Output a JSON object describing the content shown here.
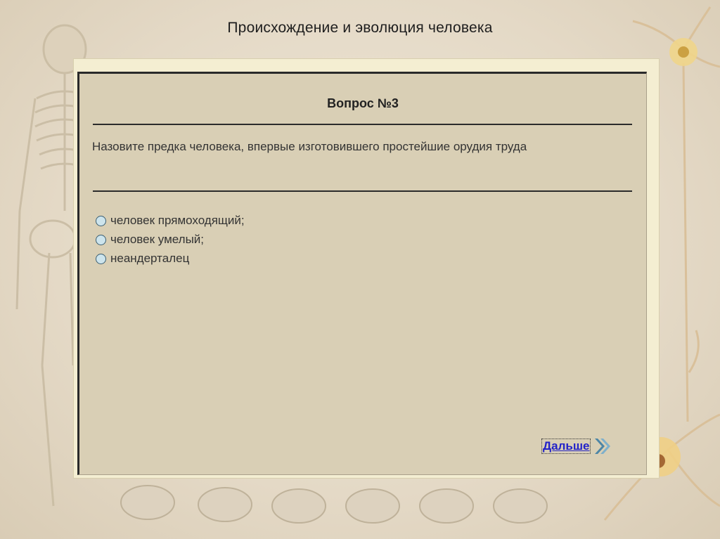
{
  "page": {
    "title": "Происхождение и эволюция человека"
  },
  "quiz": {
    "question_number": "Вопрос №3",
    "question_text": "Назовите предка человека, впервые изготовившего простейшие орудия труда",
    "options": [
      {
        "label": "человек прямоходящий;"
      },
      {
        "label": "человек умелый;"
      },
      {
        "label": "неандерталец"
      }
    ],
    "next_label": "Дальше"
  },
  "colors": {
    "panel_bg": "#d9cfb5",
    "frame_bg": "#f4eed2",
    "link": "#2323c8",
    "next_arrow": "#4e86a6"
  },
  "icons": {
    "next": "double-chevron-right-icon"
  }
}
